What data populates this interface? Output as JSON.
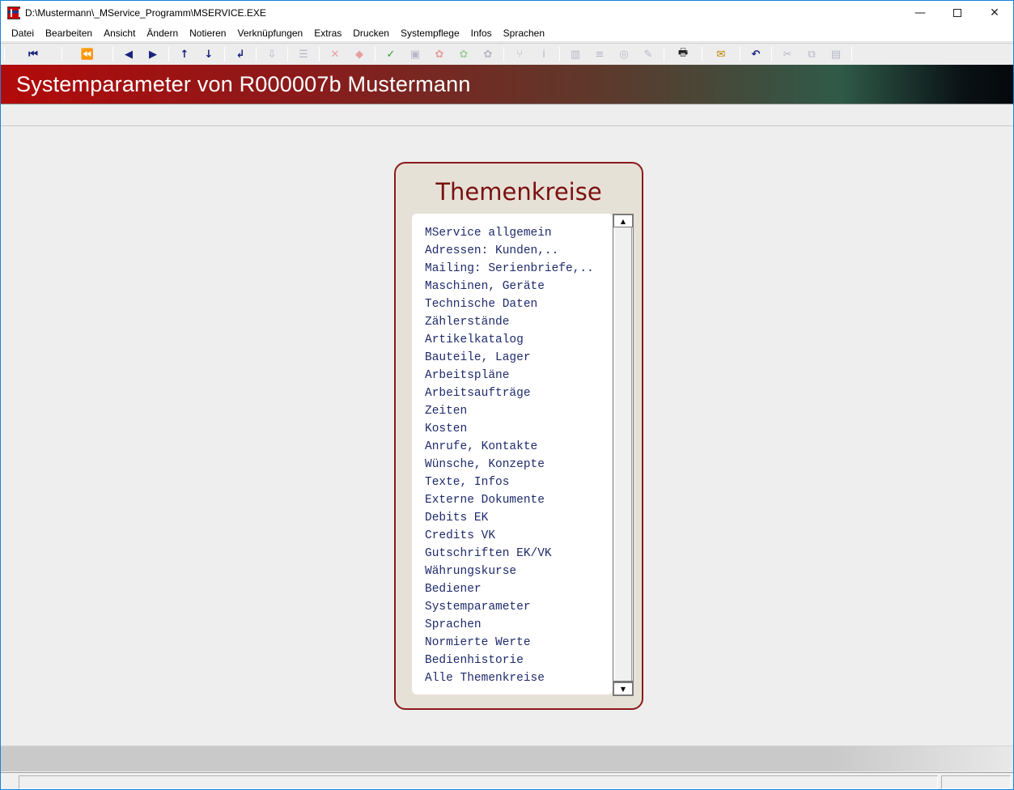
{
  "window": {
    "title": "D:\\Mustermann\\_MService_Programm\\MSERVICE.EXE",
    "controls": {
      "minimize": "—",
      "close": "✕"
    }
  },
  "menu": [
    "Datei",
    "Bearbeiten",
    "Ansicht",
    "Ändern",
    "Notieren",
    "Verknüpfungen",
    "Extras",
    "Drucken",
    "Systempflege",
    "Infos",
    "Sprachen"
  ],
  "toolbar": {
    "first_record": "⏮",
    "prev_page": "⏪",
    "prev_record": "◀",
    "next_record": "▶",
    "up": "↑",
    "down": "↓",
    "enter": "↲",
    "import": "⇩",
    "list": "☰",
    "delete": "✕",
    "erase": "◆",
    "confirm": "✓",
    "save": "▣",
    "link1": "✿",
    "link2": "✿",
    "link3": "✿",
    "branch": "⑂",
    "info": "ⅰ",
    "compare": "▥",
    "lines": "≡",
    "view": "◎",
    "edit": "✎",
    "print": "🖶",
    "mail": "✉",
    "undo": "↶",
    "cut": "✂",
    "copy": "⧉",
    "paste": "▤"
  },
  "banner": {
    "title": "Systemparameter von R000007b Mustermann"
  },
  "panel": {
    "title": "Themenkreise",
    "items": [
      "MService allgemein",
      "Adressen: Kunden,..",
      "Mailing: Serienbriefe,..",
      "Maschinen, Geräte",
      "Technische Daten",
      "Zählerstände",
      "Artikelkatalog",
      "Bauteile, Lager",
      "Arbeitspläne",
      "Arbeitsaufträge",
      "Zeiten",
      "Kosten",
      "Anrufe, Kontakte",
      "Wünsche, Konzepte",
      "Texte, Infos",
      "Externe Dokumente",
      "Debits EK",
      "Credits VK",
      "Gutschriften EK/VK",
      "Währungskurse",
      "Bediener",
      "Systemparameter",
      "Sprachen",
      "Normierte Werte",
      "Bedienhistorie",
      "Alle Themenkreise"
    ],
    "scroll": {
      "up": "▲",
      "down": "▼"
    }
  }
}
